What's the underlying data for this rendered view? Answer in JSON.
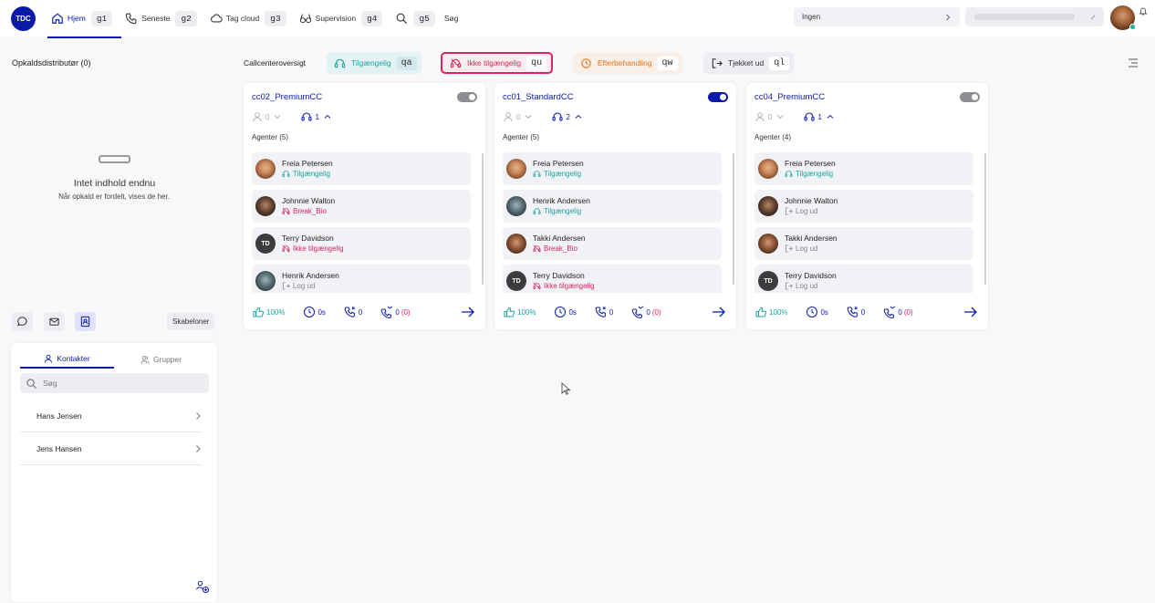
{
  "topbar": {
    "logo": "TDC",
    "nav": [
      {
        "label": "Hjem",
        "key": "g1",
        "icon": "home-icon"
      },
      {
        "label": "Seneste",
        "key": "g2",
        "icon": "phone-icon"
      },
      {
        "label": "Tag cloud",
        "key": "g3",
        "icon": "cloud-icon"
      },
      {
        "label": "Supervision",
        "key": "g4",
        "icon": "glasses-icon"
      },
      {
        "label": "Søg",
        "key": "g5",
        "icon": "search-icon"
      }
    ],
    "select1": "Ingen"
  },
  "left": {
    "title": "Opkaldsdistributør (0)",
    "empty_title": "Intet indhold endnu",
    "empty_sub": "Når opkald er fordelt, vises de her.",
    "templates_label": "Skabeloner"
  },
  "contacts": {
    "tab_contacts": "Kontakter",
    "tab_groups": "Grupper",
    "search_placeholder": "Søg",
    "items": [
      "Hans Jensen",
      "Jens Hansen"
    ]
  },
  "filters": {
    "label": "Callcenteroversigt",
    "buttons": [
      {
        "label": "Tilgængelig",
        "key": "qa"
      },
      {
        "label": "Ikke tilgængelig",
        "key": "qu"
      },
      {
        "label": "Efterbehandling",
        "key": "qw"
      },
      {
        "label": "Tjekket ud",
        "key": "ql"
      }
    ]
  },
  "cards": [
    {
      "title": "cc02_PremiumCC",
      "toggle_on": false,
      "waiting": "0",
      "agents_count": "1",
      "agents_header": "Agenter (5)",
      "agents": [
        {
          "name": "Freia Petersen",
          "status": "Tilgængelig",
          "type": "teal",
          "pic": "f"
        },
        {
          "name": "Johnnie Walton",
          "status": "Break_Bio",
          "type": "red",
          "pic": "j"
        },
        {
          "name": "Terry Davidson",
          "status": "Ikke tilgængelig",
          "type": "red",
          "pic": "td"
        },
        {
          "name": "Henrik Andersen",
          "status": "Log ud",
          "type": "grey",
          "pic": "h"
        }
      ],
      "footer": {
        "sla": "100%",
        "time": "0s",
        "calls": "0",
        "missed": "0",
        "missed_paren": "(0)"
      }
    },
    {
      "title": "cc01_StandardCC",
      "toggle_on": true,
      "waiting": "0",
      "agents_count": "2",
      "agents_header": "Agenter (5)",
      "agents": [
        {
          "name": "Freia Petersen",
          "status": "Tilgængelig",
          "type": "teal",
          "pic": "f"
        },
        {
          "name": "Henrik Andersen",
          "status": "Tilgængelig",
          "type": "teal",
          "pic": "h"
        },
        {
          "name": "Takki Andersen",
          "status": "Break_Bio",
          "type": "red",
          "pic": "t"
        },
        {
          "name": "Terry Davidson",
          "status": "Ikke tilgængelig",
          "type": "red",
          "pic": "td"
        }
      ],
      "footer": {
        "sla": "100%",
        "time": "0s",
        "calls": "0",
        "missed": "0",
        "missed_paren": "(0)"
      }
    },
    {
      "title": "cc04_PremiumCC",
      "toggle_on": false,
      "waiting": "0",
      "agents_count": "1",
      "agents_header": "Agenter (4)",
      "agents": [
        {
          "name": "Freia Petersen",
          "status": "Tilgængelig",
          "type": "teal",
          "pic": "f"
        },
        {
          "name": "Johnnie Walton",
          "status": "Log ud",
          "type": "grey",
          "pic": "j"
        },
        {
          "name": "Takki Andersen",
          "status": "Log ud",
          "type": "grey",
          "pic": "t"
        },
        {
          "name": "Terry Davidson",
          "status": "Log ud",
          "type": "grey",
          "pic": "td"
        }
      ],
      "footer": {
        "sla": "100%",
        "time": "0s",
        "calls": "0",
        "missed": "0",
        "missed_paren": "(0)"
      }
    }
  ],
  "colors": {
    "brand": "#0a1aa8",
    "available": "#19a3a3",
    "unavailable": "#d9255c",
    "after_call": "#e5741c"
  }
}
